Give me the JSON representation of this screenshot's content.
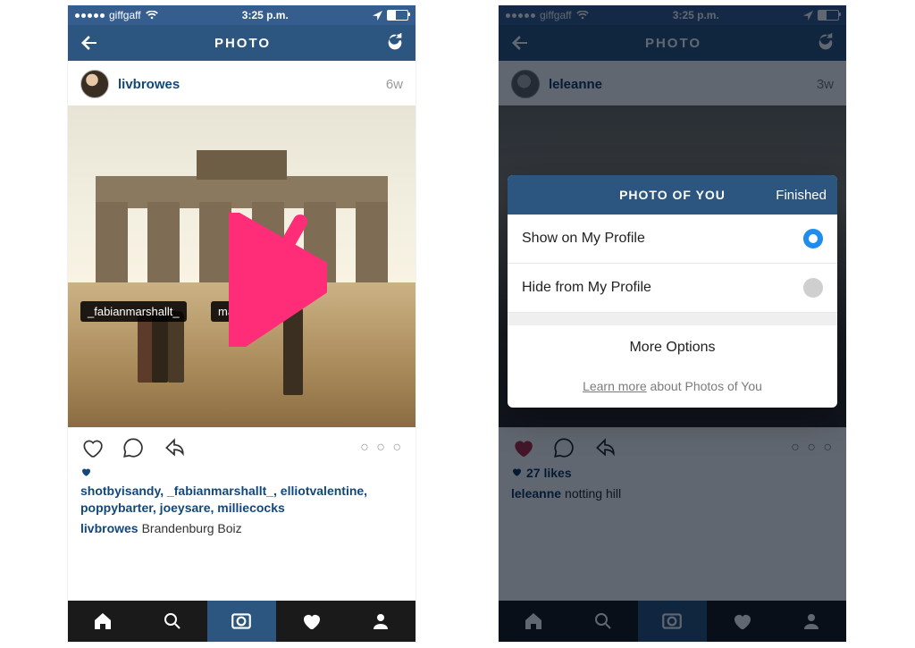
{
  "status": {
    "carrier": "giffgaff",
    "time": "3:25 p.m."
  },
  "nav": {
    "title": "PHOTO"
  },
  "left": {
    "username": "livbrowes",
    "age": "6w",
    "tags": {
      "t1": "_fabianmarshallt_",
      "t2": "max8378"
    },
    "likers_csv": "shotbyisandy, _fabianmarshallt_, elliotvalentine, poppybarter, joeysare, milliecocks",
    "caption_user": "livbrowes",
    "caption_text": "Brandenburg Boiz"
  },
  "right": {
    "username": "leleanne",
    "age": "3w",
    "likes_label": "27 likes",
    "caption_user": "leleanne",
    "caption_text": "notting hill"
  },
  "modal": {
    "title": "PHOTO OF YOU",
    "done": "Finished",
    "opt_show": "Show on My Profile",
    "opt_hide": "Hide from My Profile",
    "more": "More Options",
    "learn_link": "Learn more",
    "learn_rest": " about Photos of You"
  },
  "icons": {
    "more_dots": "○ ○ ○"
  }
}
